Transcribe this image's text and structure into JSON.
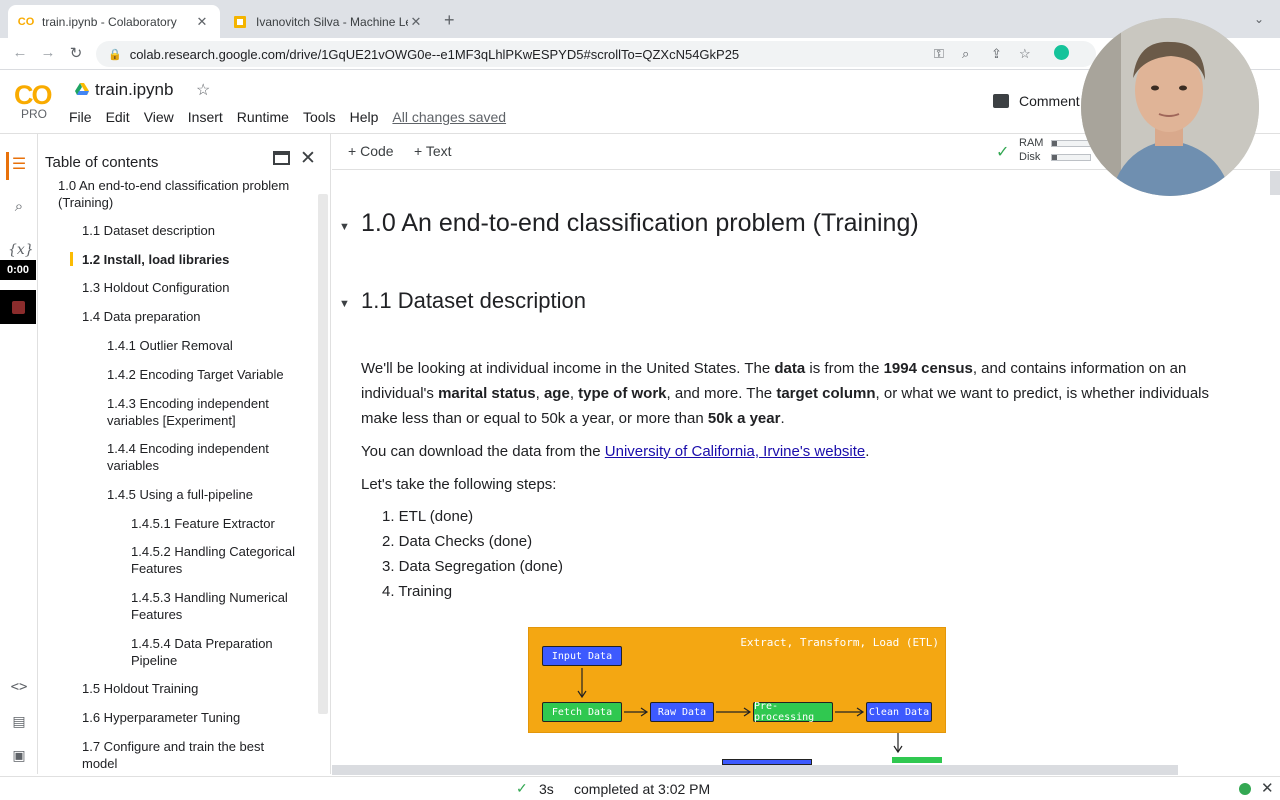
{
  "browser": {
    "tabs": [
      {
        "title": "train.ipynb - Colaboratory",
        "favicon": "CO"
      },
      {
        "title": "Ivanovitch Silva - Machine Lear",
        "favicon": "slides"
      }
    ],
    "url": "colab.research.google.com/drive/1GqUE21vOWG0e--e1MF3qLhlPKwESPYD5#scrollTo=QZXcN54GkP25"
  },
  "colab": {
    "logo": "CO",
    "pro_label": "PRO",
    "notebook_title": "train.ipynb",
    "menu": [
      "File",
      "Edit",
      "View",
      "Insert",
      "Runtime",
      "Tools",
      "Help"
    ],
    "saved_status": "All changes saved",
    "comment_label": "Comment"
  },
  "rail": {
    "variables_label": "{x}",
    "timer": "0:00"
  },
  "toc": {
    "title": "Table of contents",
    "items": [
      {
        "text": "1.0 An end-to-end classification problem (Training)"
      },
      {
        "text": "1.1 Dataset description"
      },
      {
        "text": "1.2 Install, load libraries"
      },
      {
        "text": "1.3 Holdout Configuration"
      },
      {
        "text": "1.4 Data preparation"
      },
      {
        "text": "1.4.1 Outlier Removal"
      },
      {
        "text": "1.4.2 Encoding Target Variable"
      },
      {
        "text": "1.4.3 Encoding independent variables [Experiment]"
      },
      {
        "text": "1.4.4 Encoding independent variables"
      },
      {
        "text": "1.4.5 Using a full-pipeline"
      },
      {
        "text": "1.4.5.1 Feature Extractor"
      },
      {
        "text": "1.4.5.2 Handling Categorical Features"
      },
      {
        "text": "1.4.5.3 Handling Numerical Features"
      },
      {
        "text": "1.4.5.4 Data Preparation Pipeline"
      },
      {
        "text": "1.5 Holdout Training"
      },
      {
        "text": "1.6 Hyperparameter Tuning"
      },
      {
        "text": "1.7 Configure and train the best model"
      }
    ]
  },
  "toolbar": {
    "code_label": "Code",
    "text_label": "Text",
    "ram_label": "RAM",
    "disk_label": "Disk"
  },
  "notebook": {
    "h1": "1.0 An end-to-end classification problem (Training)",
    "h2": "1.1 Dataset description",
    "p1": {
      "t1": "We'll be looking at individual income in the United States. The ",
      "b1": "data",
      "t2": " is from the ",
      "b2": "1994 census",
      "t3": ", and contains information on an individual's ",
      "b3": "marital status",
      "t4": ", ",
      "b4": "age",
      "t5": ", ",
      "b5": "type of work",
      "t6": ", and more. The ",
      "b6": "target column",
      "t7": ", or what we want to predict, is whether individuals make less than or equal to 50k a year, or more than ",
      "b7": "50k a year",
      "t8": "."
    },
    "p2": {
      "t1": "You can download the data from the ",
      "link": "University of California, Irvine's website",
      "t2": "."
    },
    "p3": "Let's take the following steps:",
    "steps": [
      "1. ETL (done)",
      "2. Data Checks (done)",
      "3. Data Segregation (done)",
      "4. Training"
    ]
  },
  "diagram": {
    "title": "Extract, Transform, Load (ETL)",
    "boxes": [
      "Input Data",
      "Fetch Data",
      "Raw Data",
      "Pre-processing",
      "Clean Data"
    ],
    "colors": {
      "background": "#f4a712",
      "blue": "#3d5afe",
      "green": "#30c850"
    }
  },
  "status": {
    "duration": "3s",
    "completed": "completed at 3:02 PM"
  }
}
